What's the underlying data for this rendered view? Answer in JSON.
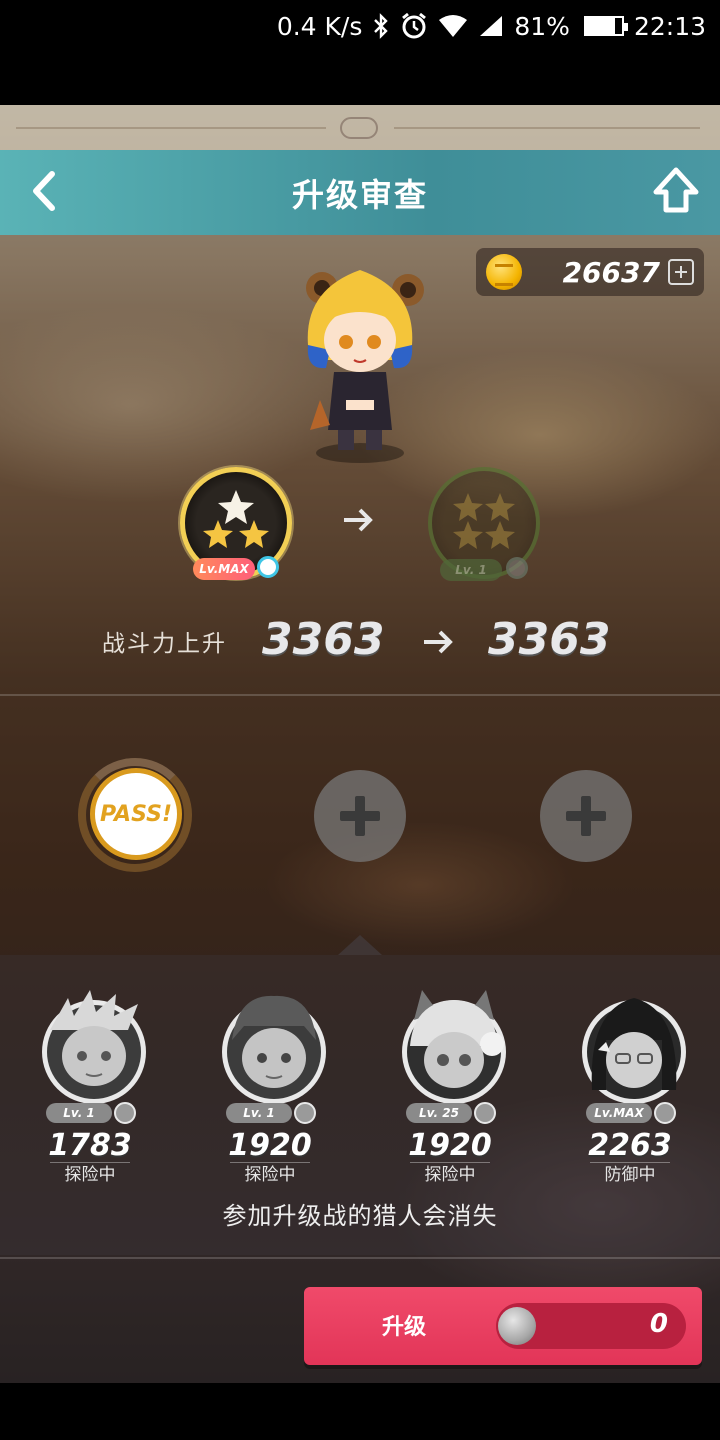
{
  "status_bar": {
    "network_speed": "0.4 K/s",
    "battery": "81%",
    "time": "22:13",
    "icons": [
      "bluetooth-icon",
      "alarm-icon",
      "wifi-icon",
      "signal-icon",
      "battery-icon"
    ],
    "battery_level": 0.81
  },
  "header": {
    "title": "升级审查",
    "back_icon": "chevron-left-icon",
    "home_icon": "home-icon"
  },
  "currency": {
    "amount": "26637",
    "coin_icon": "gold-coin-icon",
    "add_icon": "plus-square-icon"
  },
  "grade": {
    "current_stars": 3,
    "current_level": "Lv.MAX",
    "next_stars": 4,
    "next_level": "Lv. 1"
  },
  "power": {
    "label": "战斗力上升",
    "from": "3363",
    "to": "3363"
  },
  "slots": {
    "pass_label": "PASS!",
    "empty_count": 2
  },
  "hunters": [
    {
      "level": "Lv. 1",
      "power": "1783",
      "status": "探险中",
      "icon": "hand-icon"
    },
    {
      "level": "Lv. 1",
      "power": "1920",
      "status": "探险中",
      "icon": "hand-icon"
    },
    {
      "level": "Lv. 25",
      "power": "1920",
      "status": "探险中",
      "icon": "hand-icon"
    },
    {
      "level": "Lv.MAX",
      "power": "2263",
      "status": "防御中",
      "icon": "gem-icon"
    }
  ],
  "notice": "参加升级战的猎人会消失",
  "upgrade": {
    "label": "升级",
    "cost": "0"
  },
  "colors": {
    "header": "#4a98a3",
    "button": "#e23558",
    "gold": "#f4b400"
  }
}
